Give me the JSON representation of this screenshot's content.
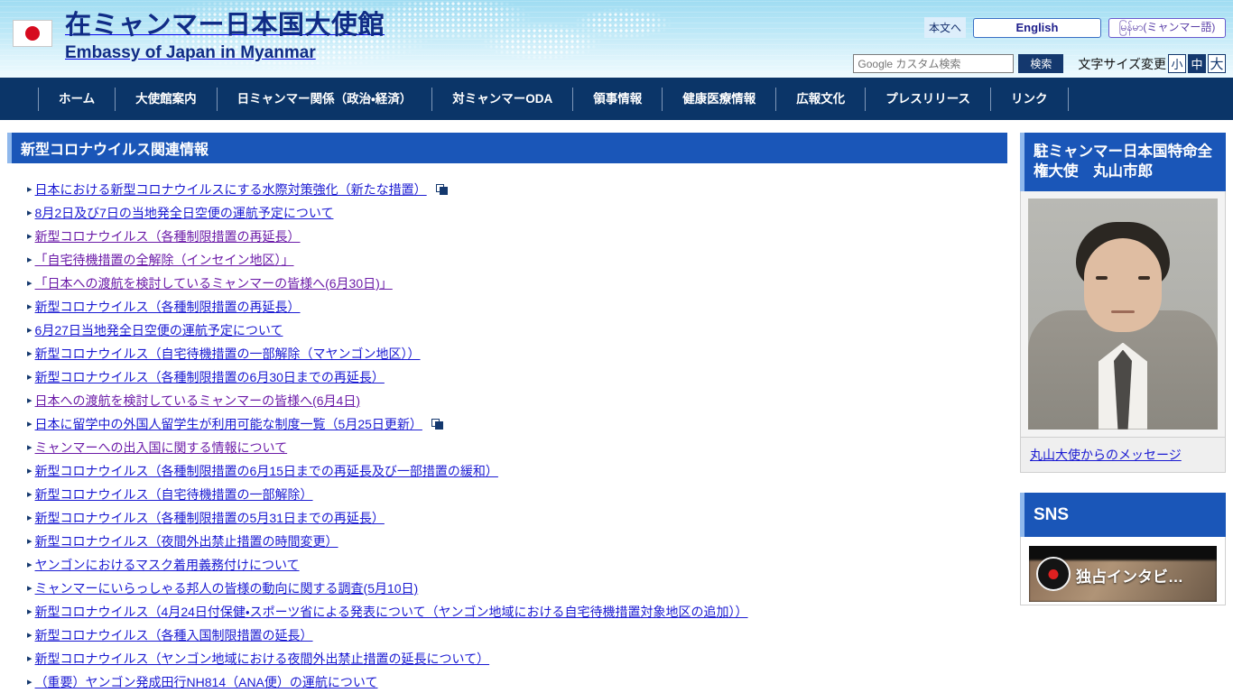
{
  "header": {
    "site_title_jp": "在ミャンマー日本国大使館",
    "site_title_en": "Embassy of Japan in Myanmar",
    "flag_icon": "japan-flag-icon",
    "skip_link": "本文へ",
    "lang_english": "English",
    "lang_myanmar": "မြန်မာ(ミャンマー語)",
    "search_placeholder": "Google カスタム検索",
    "search_button": "検索",
    "fontsize_label": "文字サイズ変更",
    "fontsize_small": "小",
    "fontsize_medium": "中",
    "fontsize_large": "大",
    "fontsize_selected": "中"
  },
  "nav": {
    "items": [
      {
        "label": "ホーム"
      },
      {
        "label": "大使館案内"
      },
      {
        "label": "日ミャンマー関係（政治・経済）"
      },
      {
        "label": "対ミャンマーODA"
      },
      {
        "label": "領事情報"
      },
      {
        "label": "健康医療情報"
      },
      {
        "label": "広報文化"
      },
      {
        "label": "プレスリリース"
      },
      {
        "label": "リンク"
      }
    ]
  },
  "main": {
    "section_title": "新型コロナウイルス関連情報",
    "links": [
      {
        "label": "日本における新型コロナウイルスにする水際対策強化（新たな措置）",
        "visited": false,
        "external": true
      },
      {
        "label": "8月2日及び7日の当地発全日空便の運航予定について",
        "visited": false,
        "external": false
      },
      {
        "label": "新型コロナウイルス（各種制限措置の再延長）",
        "visited": true,
        "external": false
      },
      {
        "label": "「自宅待機措置の全解除（インセイン地区）」",
        "visited": true,
        "external": false
      },
      {
        "label": "「日本への渡航を検討しているミャンマーの皆様へ(6月30日)」",
        "visited": true,
        "external": false
      },
      {
        "label": "新型コロナウイルス（各種制限措置の再延長）",
        "visited": false,
        "external": false
      },
      {
        "label": "6月27日当地発全日空便の運航予定について",
        "visited": false,
        "external": false
      },
      {
        "label": "新型コロナウイルス（自宅待機措置の一部解除（マヤンゴン地区））",
        "visited": false,
        "external": false
      },
      {
        "label": "新型コロナウイルス（各種制限措置の6月30日までの再延長）",
        "visited": false,
        "external": false
      },
      {
        "label": "日本への渡航を検討しているミャンマーの皆様へ(6月4日)",
        "visited": true,
        "external": false
      },
      {
        "label": "日本に留学中の外国人留学生が利用可能な制度一覧（5月25日更新）",
        "visited": false,
        "external": true
      },
      {
        "label": "ミャンマーへの出入国に関する情報について",
        "visited": true,
        "external": false
      },
      {
        "label": "新型コロナウイルス（各種制限措置の6月15日までの再延長及び一部措置の緩和）",
        "visited": false,
        "external": false
      },
      {
        "label": "新型コロナウイルス（自宅待機措置の一部解除）",
        "visited": false,
        "external": false
      },
      {
        "label": "新型コロナウイルス（各種制限措置の5月31日までの再延長）",
        "visited": false,
        "external": false
      },
      {
        "label": "新型コロナウイルス（夜間外出禁止措置の時間変更）",
        "visited": false,
        "external": false
      },
      {
        "label": "ヤンゴンにおけるマスク着用義務付けについて",
        "visited": false,
        "external": false
      },
      {
        "label": "ミャンマーにいらっしゃる邦人の皆様の動向に関する調査(5月10日)",
        "visited": false,
        "external": false
      },
      {
        "label": "新型コロナウイルス（4月24日付保健・スポーツ省による発表について（ヤンゴン地域における自宅待機措置対象地区の追加））",
        "visited": false,
        "external": false
      },
      {
        "label": "新型コロナウイルス（各種入国制限措置の延長）",
        "visited": false,
        "external": false
      },
      {
        "label": "新型コロナウイルス（ヤンゴン地域における夜間外出禁止措置の延長について）",
        "visited": false,
        "external": false
      },
      {
        "label": "（重要）ヤンゴン発成田行NH814（ANA便）の運航について",
        "visited": false,
        "external": false
      }
    ]
  },
  "sidebar": {
    "ambassador_title": "駐ミャンマー日本国特命全権大使　丸山市郎",
    "ambassador_photo": "ambassador-portrait",
    "ambassador_message_link": "丸山大使からのメッセージ",
    "sns_title": "SNS",
    "video_caption": "独占インタビ…",
    "video_logo": "broadcaster-logo-icon"
  },
  "colors": {
    "nav_bg": "#0b3568",
    "accent_blue": "#1a56b8",
    "accent_light": "#8fb8ec",
    "link": "#1a1ad2",
    "link_visited": "#6b1ba8",
    "header_gradient_top": "#9fdcf2",
    "header_gradient_bottom": "#eefaff"
  }
}
